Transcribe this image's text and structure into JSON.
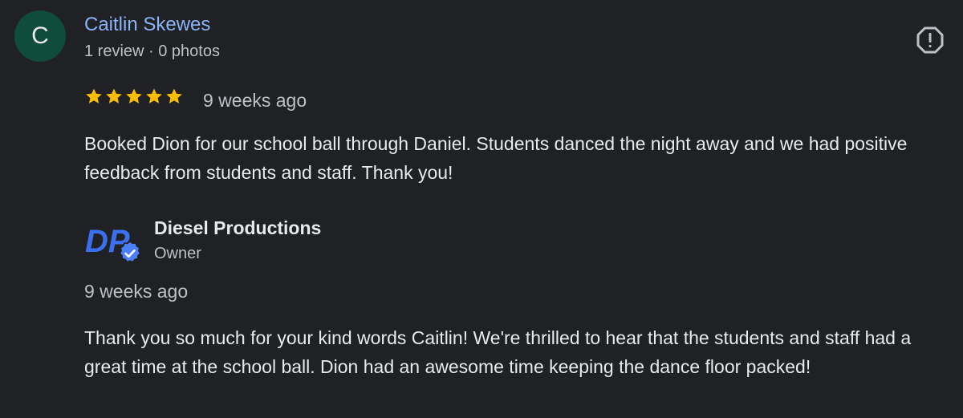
{
  "review": {
    "avatar_letter": "C",
    "reviewer_name": "Caitlin Skewes",
    "reviewer_meta": "1 review · 0 photos",
    "rating": 5,
    "rating_max": 5,
    "time": "9 weeks ago",
    "text": "Booked Dion for our school ball through Daniel. Students danced the night away and we had positive feedback from students and staff. Thank you!"
  },
  "owner_reply": {
    "name": "Diesel Productions",
    "role": "Owner",
    "logo_text": "DP",
    "time": "9 weeks ago",
    "text": "Thank you so much for your kind words Caitlin! We're thrilled to hear that the students and staff had a great time at the school ball. Dion had an awesome time keeping the dance floor packed!"
  },
  "icons": {
    "report": "report-flag-icon",
    "star": "star-icon",
    "verified": "verified-badge-icon"
  },
  "colors": {
    "background": "#202124",
    "avatar_bg": "#0f4d3a",
    "name_link": "#8ab4f8",
    "star": "#fbbc04",
    "logo_blue": "#3b6ff0"
  }
}
